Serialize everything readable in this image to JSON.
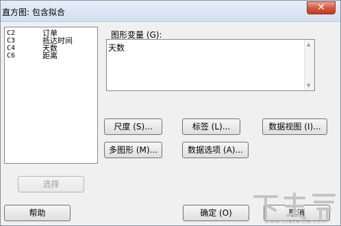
{
  "window": {
    "title": "直方图: 包含拟合",
    "close_glyph": "✕"
  },
  "variables_list": [
    {
      "id": "C2",
      "name": "订单"
    },
    {
      "id": "C3",
      "name": "抵达时间"
    },
    {
      "id": "C4",
      "name": "天数"
    },
    {
      "id": "C6",
      "name": "距离"
    }
  ],
  "graph_variables": {
    "label": "图形变量 (G):",
    "value": "天数"
  },
  "buttons": {
    "scale": "尺度 (S)...",
    "labels": "标签 (L)...",
    "data_view": "数据视图 (I)...",
    "multiple_graphs": "多图形 (M)...",
    "data_options": "数据选项 (A)...",
    "select": "选择",
    "help": "帮助",
    "ok": "确定 (O)",
    "cancel": "取消"
  },
  "watermark": {
    "logo_text": "下载吧",
    "url_text": "www.xiazaiba.com"
  }
}
